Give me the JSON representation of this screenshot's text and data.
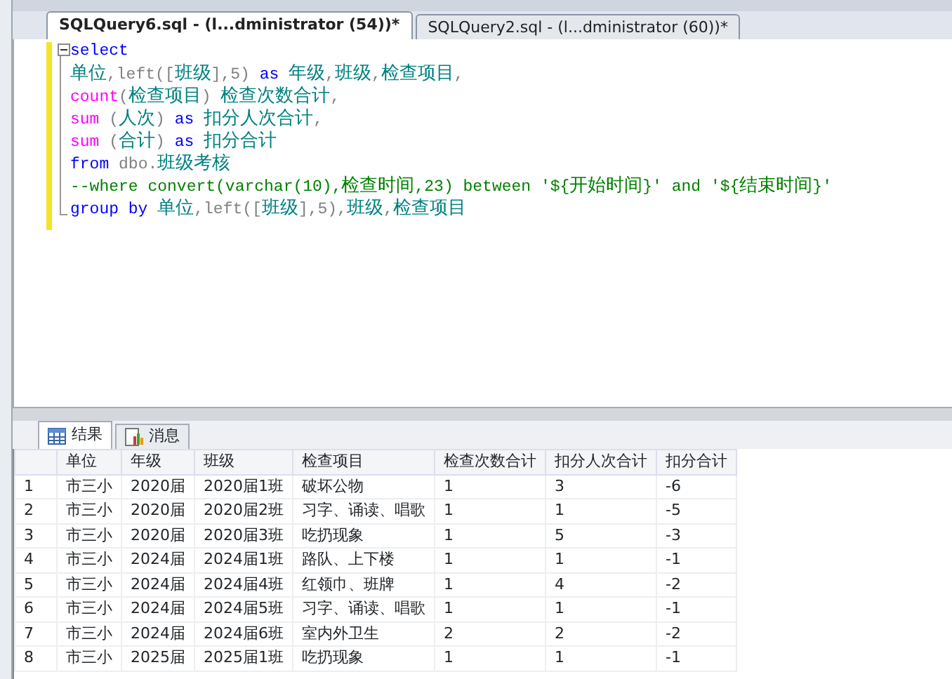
{
  "editor_tabs": [
    {
      "label": "SQLQuery6.sql - (l...dministrator (54))*",
      "selected": true
    },
    {
      "label": "SQLQuery2.sql - (l...dministrator (60))*",
      "selected": false
    }
  ],
  "code_lines": [
    [
      {
        "kind": "kw",
        "text": "select"
      }
    ],
    [
      {
        "kind": "id",
        "text": "单位"
      },
      {
        "kind": "op",
        "text": ",left(["
      },
      {
        "kind": "id",
        "text": "班级"
      },
      {
        "kind": "op",
        "text": "],5) "
      },
      {
        "kind": "kw",
        "text": "as"
      },
      {
        "kind": "id",
        "text": " 年级"
      },
      {
        "kind": "op",
        "text": ","
      },
      {
        "kind": "id",
        "text": "班级"
      },
      {
        "kind": "op",
        "text": ","
      },
      {
        "kind": "id",
        "text": "检查项目"
      },
      {
        "kind": "op",
        "text": ","
      }
    ],
    [
      {
        "kind": "fn",
        "text": "count"
      },
      {
        "kind": "op",
        "text": "("
      },
      {
        "kind": "id",
        "text": "检查项目"
      },
      {
        "kind": "op",
        "text": ") "
      },
      {
        "kind": "id",
        "text": "检查次数合计"
      },
      {
        "kind": "op",
        "text": ","
      }
    ],
    [
      {
        "kind": "fn",
        "text": "sum"
      },
      {
        "kind": "op",
        "text": " ("
      },
      {
        "kind": "id",
        "text": "人次"
      },
      {
        "kind": "op",
        "text": ") "
      },
      {
        "kind": "kw",
        "text": "as"
      },
      {
        "kind": "id",
        "text": " 扣分人次合计"
      },
      {
        "kind": "op",
        "text": ","
      }
    ],
    [
      {
        "kind": "fn",
        "text": "sum"
      },
      {
        "kind": "op",
        "text": " ("
      },
      {
        "kind": "id",
        "text": "合计"
      },
      {
        "kind": "op",
        "text": ") "
      },
      {
        "kind": "kw",
        "text": "as"
      },
      {
        "kind": "id",
        "text": " 扣分合计"
      }
    ],
    [
      {
        "kind": "kw",
        "text": "from"
      },
      {
        "kind": "op",
        "text": " dbo."
      },
      {
        "kind": "id",
        "text": "班级考核"
      }
    ],
    [
      {
        "kind": "cm",
        "text": "--where convert(varchar(10),检查时间,23) between '${开始时间}' and '${结束时间}'"
      }
    ],
    [
      {
        "kind": "kw",
        "text": "group by"
      },
      {
        "kind": "id",
        "text": " 单位"
      },
      {
        "kind": "op",
        "text": ",left(["
      },
      {
        "kind": "id",
        "text": "班级"
      },
      {
        "kind": "op",
        "text": "],5),"
      },
      {
        "kind": "id",
        "text": "班级"
      },
      {
        "kind": "op",
        "text": ","
      },
      {
        "kind": "id",
        "text": "检查项目"
      }
    ]
  ],
  "result_tabs": [
    {
      "label": "结果",
      "kind": "grid",
      "selected": true
    },
    {
      "label": "消息",
      "kind": "messages",
      "selected": false
    }
  ],
  "table": {
    "columns": [
      "单位",
      "年级",
      "班级",
      "检查项目",
      "检查次数合计",
      "扣分人次合计",
      "扣分合计"
    ],
    "rows": [
      {
        "row_number": "1",
        "cells": [
          "市三小",
          "2020届",
          "2020届1班",
          "破坏公物",
          "1",
          "3",
          "-6"
        ]
      },
      {
        "row_number": "2",
        "cells": [
          "市三小",
          "2020届",
          "2020届2班",
          "习字、诵读、唱歌",
          "1",
          "1",
          "-5"
        ]
      },
      {
        "row_number": "3",
        "cells": [
          "市三小",
          "2020届",
          "2020届3班",
          "吃扔现象",
          "1",
          "5",
          "-3"
        ]
      },
      {
        "row_number": "4",
        "cells": [
          "市三小",
          "2024届",
          "2024届1班",
          "路队、上下楼",
          "1",
          "1",
          "-1"
        ]
      },
      {
        "row_number": "5",
        "cells": [
          "市三小",
          "2024届",
          "2024届4班",
          "红领巾、班牌",
          "1",
          "4",
          "-2"
        ]
      },
      {
        "row_number": "6",
        "cells": [
          "市三小",
          "2024届",
          "2024届5班",
          "习字、诵读、唱歌",
          "1",
          "1",
          "-1"
        ]
      },
      {
        "row_number": "7",
        "cells": [
          "市三小",
          "2024届",
          "2024届6班",
          "室内外卫生",
          "2",
          "2",
          "-2"
        ]
      },
      {
        "row_number": "8",
        "cells": [
          "市三小",
          "2025届",
          "2025届1班",
          "吃扔现象",
          "1",
          "1",
          "-1"
        ]
      }
    ]
  }
}
